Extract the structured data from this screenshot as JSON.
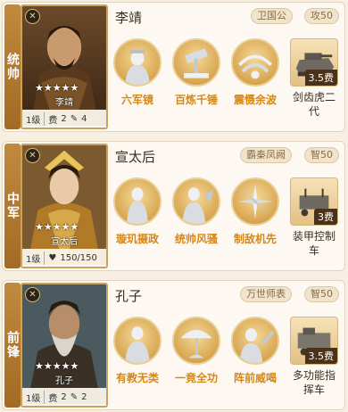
{
  "cards": [
    {
      "position": "统帅",
      "name": "李靖",
      "portrait_name": "李靖",
      "stars": "★★★★★",
      "level": "1级",
      "stat_label": "费",
      "stat_value": "2",
      "stat_extra": "4",
      "tag1": "卫国公",
      "tag2": "攻50",
      "skills": [
        "六军镜",
        "百炼千锤",
        "震慑余波"
      ],
      "equip_name": "剑齿虎二代",
      "equip_cost": "3.5费"
    },
    {
      "position": "中军",
      "name": "宣太后",
      "portrait_name": "宣太后",
      "stars": "★★★★★",
      "level": "1级",
      "stat_label": "♥",
      "stat_value": "150/150",
      "stat_extra": "",
      "tag1": "霸秦凤阙",
      "tag2": "智50",
      "skills": [
        "璇玑摄政",
        "统帅风骚",
        "制敌机先"
      ],
      "equip_name": "装甲控制车",
      "equip_cost": "3费"
    },
    {
      "position": "前锋",
      "name": "孔子",
      "portrait_name": "孔子",
      "stars": "★★★★★",
      "level": "1级",
      "stat_label": "费",
      "stat_value": "2",
      "stat_extra": "2",
      "tag1": "万世师表",
      "tag2": "智50",
      "skills": [
        "有教无类",
        "一竟全功",
        "阵前威喝"
      ],
      "equip_name": "多功能指挥车",
      "equip_cost": "3.5费"
    }
  ]
}
